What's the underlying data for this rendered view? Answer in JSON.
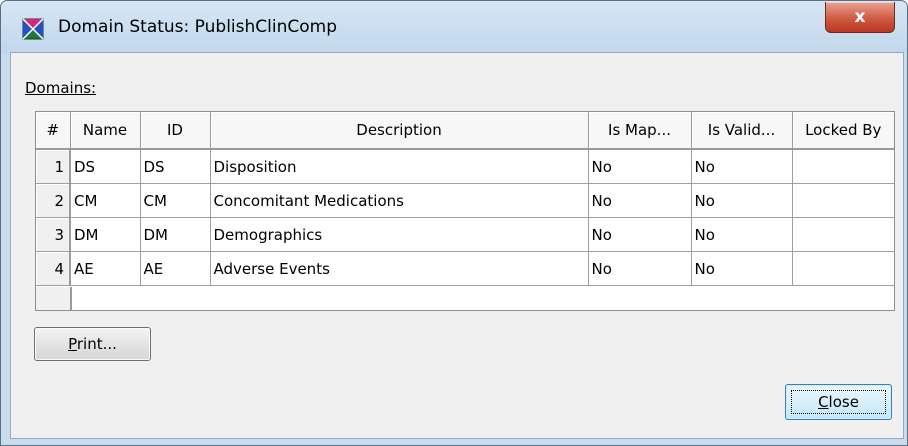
{
  "window": {
    "title": "Domain Status:  PublishClinComp",
    "close_x": "x"
  },
  "domains_label": "Domains:",
  "table": {
    "columns": [
      "#",
      "Name",
      "ID",
      "Description",
      "Is Map...",
      "Is Valid...",
      "Locked By"
    ],
    "rows": [
      {
        "num": "1",
        "name": "DS",
        "id": "DS",
        "description": "Disposition",
        "is_mapped": "No",
        "is_valid": "No",
        "locked_by": ""
      },
      {
        "num": "2",
        "name": "CM",
        "id": "CM",
        "description": "Concomitant Medications",
        "is_mapped": "No",
        "is_valid": "No",
        "locked_by": ""
      },
      {
        "num": "3",
        "name": "DM",
        "id": "DM",
        "description": "Demographics",
        "is_mapped": "No",
        "is_valid": "No",
        "locked_by": ""
      },
      {
        "num": "4",
        "name": "AE",
        "id": "AE",
        "description": "Adverse Events",
        "is_mapped": "No",
        "is_valid": "No",
        "locked_by": ""
      }
    ]
  },
  "buttons": {
    "print_mnemonic": "P",
    "print_rest": "rint...",
    "close_mnemonic": "C",
    "close_rest": "lose"
  }
}
